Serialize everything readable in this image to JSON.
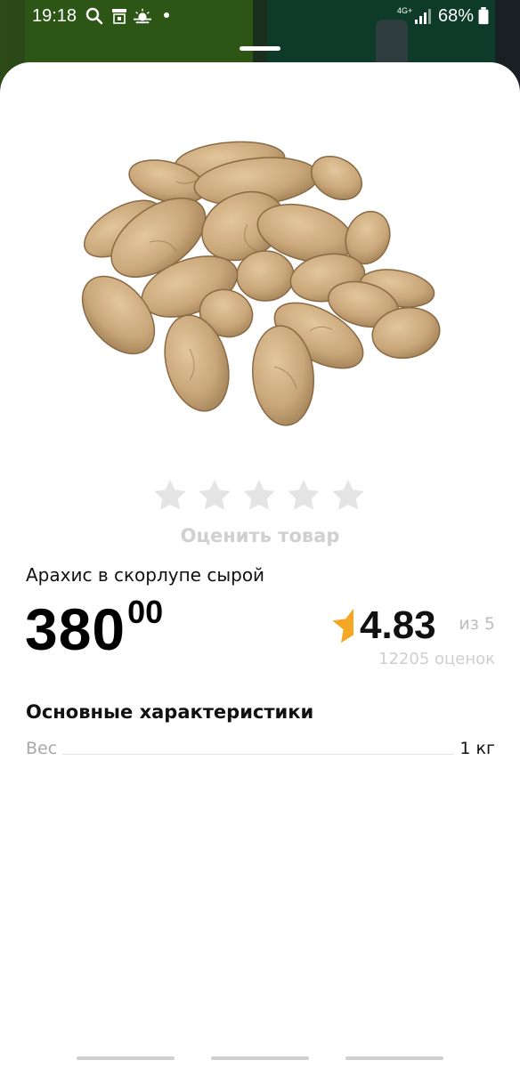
{
  "status_bar": {
    "time": "19:18",
    "network": "4G+",
    "battery": "68%"
  },
  "product": {
    "image_icon": "peanuts-image",
    "rate_label": "Оценить товар",
    "name": "Арахис в скорлупе сырой",
    "price_main": "380",
    "price_cents": "00",
    "rating_value": "4.83",
    "rating_of": "из 5",
    "rating_count": "12205 оценок"
  },
  "characteristics": {
    "title": "Основные характеристики",
    "rows": [
      {
        "key": "Вес",
        "value": "1 кг"
      }
    ]
  },
  "colors": {
    "accent_star": "#f5a623",
    "empty_star": "#e4e4e4"
  }
}
